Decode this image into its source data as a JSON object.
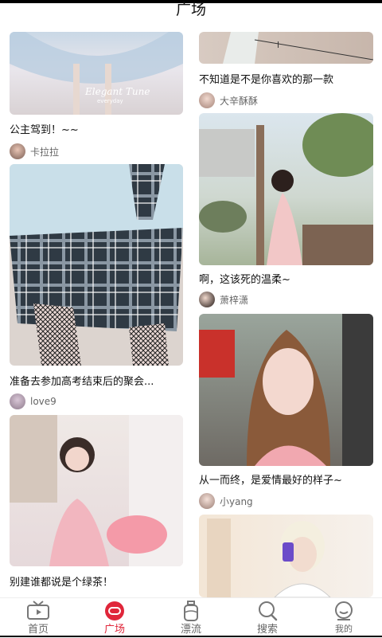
{
  "header": {
    "title": "广场"
  },
  "left": [
    {
      "title": "公主驾到！~~",
      "user": "卡拉拉",
      "overlay_line1": "Elegant Tune",
      "overlay_line2": "everyday"
    },
    {
      "title": "准备去参加高考结束后的聚会...",
      "user": "love9"
    },
    {
      "title": "别建谁都说是个绿茶！",
      "user": ""
    }
  ],
  "right": [
    {
      "title": "不知道是不是你喜欢的那一款",
      "user": "大辛酥酥"
    },
    {
      "title": "啊，这该死的温柔~",
      "user": "萧梓潇"
    },
    {
      "title": "从一而终，是爱情最好的样子~",
      "user": "小yang"
    },
    {
      "title": "",
      "user": ""
    }
  ],
  "tabs": [
    {
      "label": "首页",
      "icon": "tv-icon"
    },
    {
      "label": "广场",
      "icon": "plaza-icon"
    },
    {
      "label": "漂流",
      "icon": "bottle-icon"
    },
    {
      "label": "搜索",
      "icon": "search-icon"
    },
    {
      "label": "我的",
      "icon": "smile-icon"
    }
  ],
  "colors": {
    "accent": "#e0263a",
    "text": "#111111",
    "muted": "#666666"
  }
}
